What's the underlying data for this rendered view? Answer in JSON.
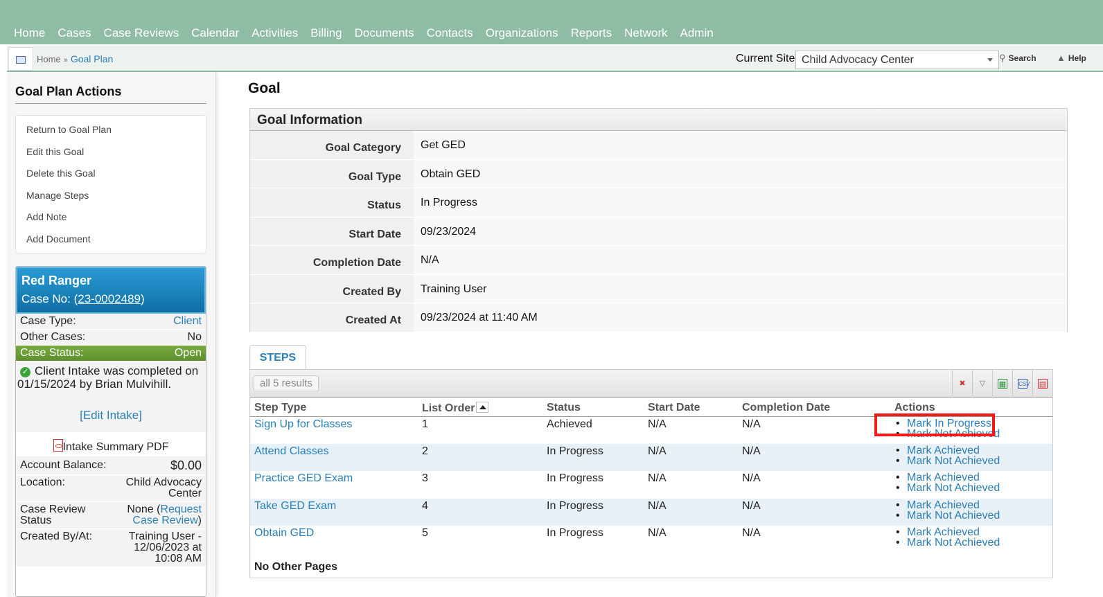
{
  "nav": [
    "Home",
    "Cases",
    "Case Reviews",
    "Calendar",
    "Activities",
    "Billing",
    "Documents",
    "Contacts",
    "Organizations",
    "Reports",
    "Network",
    "Admin"
  ],
  "breadcrumb": {
    "home": "Home",
    "sep": "»",
    "current": "Goal Plan"
  },
  "site": {
    "label": "Current Site",
    "value": "Child Advocacy Center",
    "search": "Search",
    "help": "Help"
  },
  "sidebar": {
    "title": "Goal Plan Actions",
    "actions": [
      "Return to Goal Plan",
      "Edit this Goal",
      "Delete this Goal",
      "Manage Steps",
      "Add Note",
      "Add Document"
    ]
  },
  "case": {
    "name": "Red Ranger",
    "case_no_label": "Case No: (",
    "case_no": "23-0002489",
    "case_no_close": ")",
    "case_type_label": "Case Type:",
    "case_type": "Client",
    "other_cases_label": "Other Cases:",
    "other_cases": "No",
    "status_label": "Case Status:",
    "status": "Open",
    "intake_text": "Client Intake was completed on 01/15/2024 by Brian Mulvihill.",
    "edit_intake": "[Edit Intake]",
    "intake_pdf": "Intake Summary PDF",
    "balance_label": "Account Balance:",
    "balance": "$0.00",
    "location_label": "Location:",
    "location": "Child Advocacy Center",
    "review_label": "Case Review Status",
    "review_none": "None (",
    "review_link": "Request Case Review",
    "review_close": ")",
    "created_label": "Created By/At:",
    "created": "Training User - 12/06/2023 at 10:08 AM"
  },
  "goal": {
    "heading": "Goal",
    "section": "Goal Information",
    "fields": [
      {
        "k": "Goal Category",
        "v": "Get GED"
      },
      {
        "k": "Goal Type",
        "v": "Obtain GED"
      },
      {
        "k": "Status",
        "v": "In Progress"
      },
      {
        "k": "Start Date",
        "v": "09/23/2024"
      },
      {
        "k": "Completion Date",
        "v": "N/A"
      },
      {
        "k": "Created By",
        "v": "Training User"
      },
      {
        "k": "Created At",
        "v": "09/23/2024 at 11:40 AM"
      }
    ]
  },
  "steps": {
    "tab": "STEPS",
    "results": "all 5 results",
    "columns": [
      "Step Type",
      "List Order",
      "Status",
      "Start Date",
      "Completion Date",
      "Actions"
    ],
    "rows": [
      {
        "type": "Sign Up for Classes",
        "order": "1",
        "status": "Achieved",
        "start": "N/A",
        "completion": "N/A",
        "a1": "Mark In Progress",
        "a2": "Mark Not Achieved"
      },
      {
        "type": "Attend Classes",
        "order": "2",
        "status": "In Progress",
        "start": "N/A",
        "completion": "N/A",
        "a1": "Mark Achieved",
        "a2": "Mark Not Achieved"
      },
      {
        "type": "Practice GED Exam",
        "order": "3",
        "status": "In Progress",
        "start": "N/A",
        "completion": "N/A",
        "a1": "Mark Achieved",
        "a2": "Mark Not Achieved"
      },
      {
        "type": "Take GED Exam",
        "order": "4",
        "status": "In Progress",
        "start": "N/A",
        "completion": "N/A",
        "a1": "Mark Achieved",
        "a2": "Mark Not Achieved"
      },
      {
        "type": "Obtain GED",
        "order": "5",
        "status": "In Progress",
        "start": "N/A",
        "completion": "N/A",
        "a1": "Mark Achieved",
        "a2": "Mark Not Achieved"
      }
    ],
    "footer": "No Other Pages",
    "toolbar_icons": [
      "clear-filter-icon",
      "filter-icon",
      "excel-icon",
      "csv-icon",
      "pdf-icon"
    ],
    "csv_label": "CSV"
  },
  "colors": {
    "nav_bg": "#8fbca5",
    "link": "#2a7fb8",
    "case_head": "#1a86c1",
    "status_green": "#6ea03a",
    "highlight": "#f01a1a"
  }
}
